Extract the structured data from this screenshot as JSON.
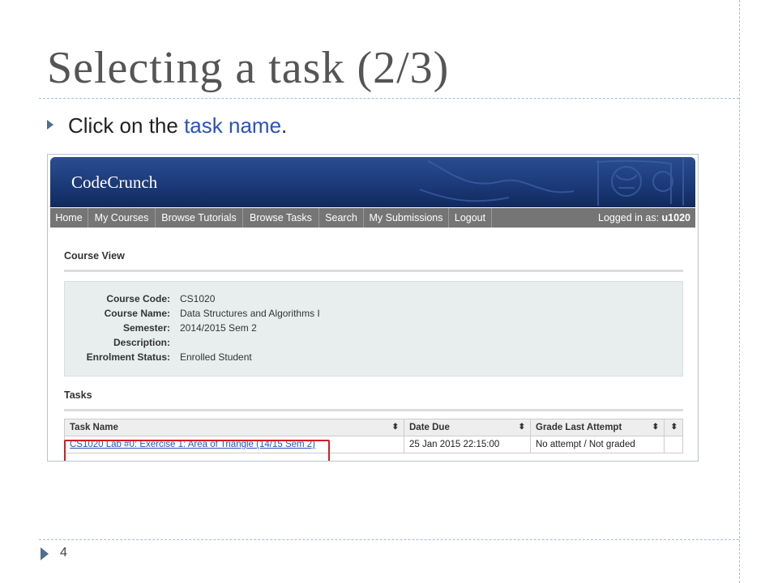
{
  "slide": {
    "title": "Selecting a task (2/3)",
    "bullet": {
      "prefix": "Click on the ",
      "highlight": "task name",
      "suffix": "."
    },
    "page_number": "4"
  },
  "app": {
    "logo": "CodeCrunch",
    "nav": [
      "Home",
      "My Courses",
      "Browse Tutorials",
      "Browse Tasks",
      "Search",
      "My Submissions",
      "Logout"
    ],
    "login": {
      "label": "Logged in as:",
      "user": "u1020"
    }
  },
  "course_view": {
    "title": "Course View",
    "fields": [
      {
        "label": "Course Code:",
        "value": "CS1020"
      },
      {
        "label": "Course Name:",
        "value": "Data Structures and Algorithms I"
      },
      {
        "label": "Semester:",
        "value": "2014/2015 Sem 2"
      },
      {
        "label": "Description:",
        "value": ""
      },
      {
        "label": "Enrolment Status:",
        "value": "Enrolled Student"
      }
    ]
  },
  "tasks": {
    "title": "Tasks",
    "columns": [
      "Task Name",
      "Date Due",
      "Grade Last Attempt"
    ],
    "sort_glyph": "⬍",
    "rows": [
      {
        "task_name": "CS1020 Lab #0: Exercise 1: Area of Triangle (14/15 Sem 2)",
        "date_due": "25 Jan 2015 22:15:00",
        "grade": "No attempt / Not graded"
      }
    ]
  },
  "colors": {
    "banner": "#1c3a79",
    "navbar": "#757575",
    "link": "#2a52be",
    "highlight_box": "#d11d25"
  }
}
